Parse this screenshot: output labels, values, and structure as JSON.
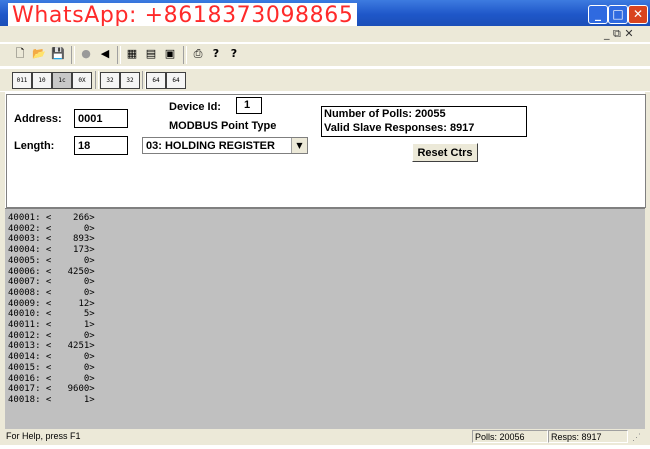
{
  "watermark": "WhatsApp: +8618373098865",
  "window_controls": {
    "minimize": "_",
    "maximize": "□",
    "close": "✕"
  },
  "mdi_controls": "_ ⧉ ✕",
  "toolbar1": [
    {
      "name": "new-file-icon",
      "glyph": "🗋"
    },
    {
      "name": "open-folder-icon",
      "glyph": "📂"
    },
    {
      "name": "save-icon",
      "glyph": "💾"
    },
    {
      "name": "stop-icon",
      "glyph": "●"
    },
    {
      "name": "connect-icon",
      "glyph": "◀"
    },
    {
      "name": "view-icon",
      "glyph": "▦"
    },
    {
      "name": "chart-icon",
      "glyph": "▤"
    },
    {
      "name": "monitor-icon",
      "glyph": "▣"
    },
    {
      "name": "print-icon",
      "glyph": "⎙"
    },
    {
      "name": "help-icon",
      "glyph": "?"
    },
    {
      "name": "context-help-icon",
      "glyph": "?"
    }
  ],
  "toolbar2": [
    {
      "name": "format-01-icon",
      "text": "011"
    },
    {
      "name": "format-10-icon",
      "text": "10"
    },
    {
      "name": "format-1c-icon",
      "text": "1c"
    },
    {
      "name": "format-0x-icon",
      "text": "0X"
    },
    {
      "name": "format-32-icon",
      "text": "32"
    },
    {
      "name": "format-32b-icon",
      "text": "32"
    },
    {
      "name": "format-64-icon",
      "text": "64"
    },
    {
      "name": "format-64b-icon",
      "text": "64"
    }
  ],
  "form": {
    "address_label": "Address:",
    "address_value": "0001",
    "length_label": "Length:",
    "length_value": "18",
    "device_id_label": "Device Id:",
    "device_id_value": "1",
    "point_type_label": "MODBUS Point Type",
    "point_type_value": "03: HOLDING REGISTER",
    "polls_text": "Number of Polls: 20055",
    "valid_text": "Valid Slave Responses: 8917",
    "reset_label": "Reset Ctrs"
  },
  "registers": [
    {
      "addr": "40001",
      "value": "266"
    },
    {
      "addr": "40002",
      "value": "0"
    },
    {
      "addr": "40003",
      "value": "893"
    },
    {
      "addr": "40004",
      "value": "173"
    },
    {
      "addr": "40005",
      "value": "0"
    },
    {
      "addr": "40006",
      "value": "4250"
    },
    {
      "addr": "40007",
      "value": "0"
    },
    {
      "addr": "40008",
      "value": "0"
    },
    {
      "addr": "40009",
      "value": "12"
    },
    {
      "addr": "40010",
      "value": "5"
    },
    {
      "addr": "40011",
      "value": "1"
    },
    {
      "addr": "40012",
      "value": "0"
    },
    {
      "addr": "40013",
      "value": "4251"
    },
    {
      "addr": "40014",
      "value": "0"
    },
    {
      "addr": "40015",
      "value": "0"
    },
    {
      "addr": "40016",
      "value": "0"
    },
    {
      "addr": "40017",
      "value": "9600"
    },
    {
      "addr": "40018",
      "value": "1"
    }
  ],
  "status": {
    "help": "For Help, press F1",
    "polls": "Polls: 20056",
    "resps": "Resps: 8917"
  },
  "colors": {
    "titlebar": "#1f57c9",
    "watermark": "#ff2a2a",
    "list_bg": "#c0c0c0",
    "chrome": "#ece9d8"
  }
}
